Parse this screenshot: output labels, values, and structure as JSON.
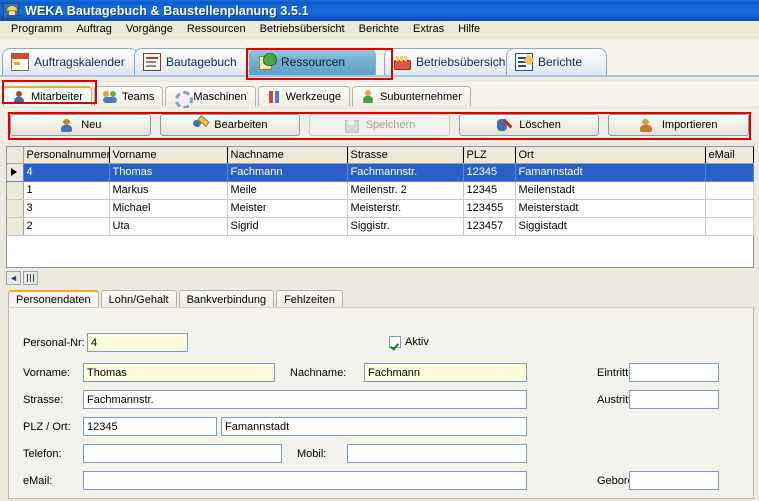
{
  "window": {
    "title": "WEKA Bautagebuch & Baustellenplanung 3.5.1",
    "icon": "hardhat-worker-icon",
    "titlebar_color": "#0a5bd3",
    "accent_color": "#e00000"
  },
  "menubar": {
    "items": [
      {
        "label": "Programm"
      },
      {
        "label": "Auftrag"
      },
      {
        "label": "Vorgänge"
      },
      {
        "label": "Ressourcen"
      },
      {
        "label": "Betriebsübersicht"
      },
      {
        "label": "Berichte"
      },
      {
        "label": "Extras"
      },
      {
        "label": "Hilfe"
      }
    ]
  },
  "main_tabs": {
    "active": "Ressourcen",
    "items": [
      {
        "label": "Auftragskalender",
        "icon": "calendar-icon",
        "active": false
      },
      {
        "label": "Bautagebuch",
        "icon": "notebook-icon",
        "active": false
      },
      {
        "label": "Ressourcen",
        "icon": "resources-icon",
        "active": true
      },
      {
        "label": "Betriebsübersicht",
        "icon": "factory-icon",
        "active": false
      },
      {
        "label": "Berichte",
        "icon": "report-icon",
        "active": false
      }
    ]
  },
  "sub_tabs": {
    "active": "Mitarbeiter",
    "items": [
      {
        "label": "Mitarbeiter",
        "icon": "person-icon",
        "active": true
      },
      {
        "label": "Teams",
        "icon": "team-icon",
        "active": false
      },
      {
        "label": "Maschinen",
        "icon": "gear-icon",
        "active": false
      },
      {
        "label": "Werkzeuge",
        "icon": "tools-icon",
        "active": false
      },
      {
        "label": "Subunternehmer",
        "icon": "subcontractor-icon",
        "active": false
      }
    ]
  },
  "toolbar": {
    "buttons": [
      {
        "label": "Neu",
        "icon": "new-person-icon",
        "disabled": false
      },
      {
        "label": "Bearbeiten",
        "icon": "edit-person-icon",
        "disabled": false
      },
      {
        "label": "Speichern",
        "icon": "save-icon",
        "disabled": true
      },
      {
        "label": "Löschen",
        "icon": "delete-person-icon",
        "disabled": false
      },
      {
        "label": "Importieren",
        "icon": "import-person-icon",
        "disabled": false
      }
    ]
  },
  "grid": {
    "columns": [
      "Personalnummer",
      "Vorname",
      "Nachname",
      "Strasse",
      "PLZ",
      "Ort",
      "eMail"
    ],
    "selected_row_index": 0,
    "rows": [
      {
        "marker": "▶",
        "cells": [
          "4",
          "Thomas",
          "Fachmann",
          "Fachmannstr.",
          "12345",
          "Famannstadt",
          ""
        ]
      },
      {
        "marker": "",
        "cells": [
          "1",
          "Markus",
          "Meile",
          "Meilenstr. 2",
          "12345",
          "Meilenstadt",
          ""
        ]
      },
      {
        "marker": "",
        "cells": [
          "3",
          "Michael",
          "Meister",
          "Meisterstr.",
          "123455",
          "Meisterstadt",
          ""
        ]
      },
      {
        "marker": "",
        "cells": [
          "2",
          "Uta",
          "Sigrid",
          "Siggistr.",
          "123457",
          "Siggistadt",
          ""
        ]
      }
    ]
  },
  "grid_nav": {
    "prev_label": "◄",
    "columns_icon": "columns-icon"
  },
  "inner_tabs": {
    "active": "Personendaten",
    "items": [
      {
        "label": "Personendaten",
        "active": true
      },
      {
        "label": "Lohn/Gehalt",
        "active": false
      },
      {
        "label": "Bankverbindung",
        "active": false
      },
      {
        "label": "Fehlzeiten",
        "active": false
      }
    ]
  },
  "form": {
    "personal_nr": {
      "label": "Personal-Nr:",
      "value": "4"
    },
    "aktiv": {
      "label": "Aktiv",
      "checked": true
    },
    "vorname": {
      "label": "Vorname:",
      "value": "Thomas"
    },
    "nachname": {
      "label": "Nachname:",
      "value": "Fachmann"
    },
    "eintritt": {
      "label": "Eintritt",
      "value": ""
    },
    "strasse": {
      "label": "Strasse:",
      "value": "Fachmannstr."
    },
    "austritt": {
      "label": "Austritt",
      "value": ""
    },
    "plz_ort": {
      "label": "PLZ / Ort:",
      "plz": "12345",
      "ort": "Famannstadt"
    },
    "telefon": {
      "label": "Telefon:",
      "value": ""
    },
    "mobil": {
      "label": "Mobil:",
      "value": ""
    },
    "email": {
      "label": "eMail:",
      "value": ""
    },
    "geboren": {
      "label": "Geboren:",
      "value": ""
    }
  }
}
